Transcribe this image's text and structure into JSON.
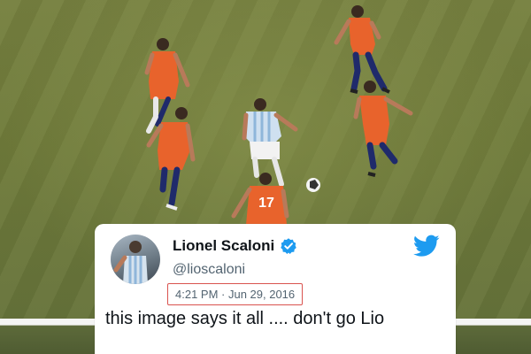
{
  "photo": {
    "jersey_number": "17",
    "colors": {
      "pitch": "#72803d",
      "chile_shirt": "#e8632c",
      "chile_shorts": "#e8632c",
      "chile_socks": "#1f2a6b",
      "argentina_shirt": "#cfe0f0",
      "argentina_shorts": "#f2f2f2"
    }
  },
  "tweet": {
    "display_name": "Lionel Scaloni",
    "handle": "@lioscaloni",
    "timestamp": "4:21 PM · Jun 29, 2016",
    "text": "this image says it all .... don't go Lio",
    "verified_icon": "verified-badge-icon",
    "platform_icon": "twitter-bird-icon",
    "colors": {
      "verified": "#1d9bf0",
      "bird": "#1d9bf0",
      "timestamp_box": "#d9534f"
    }
  }
}
